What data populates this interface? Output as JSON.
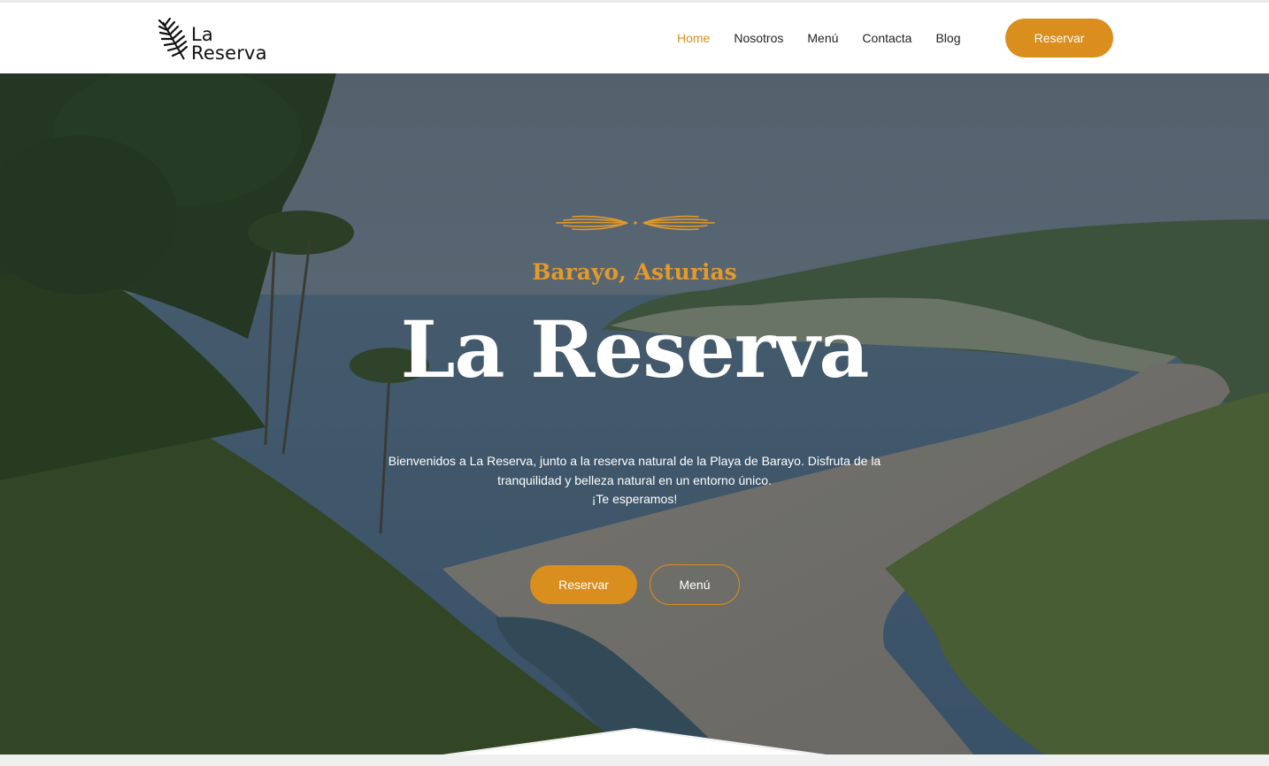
{
  "brand": {
    "logo_line1": "La",
    "logo_line2": "Reserva"
  },
  "nav": {
    "items": [
      "Home",
      "Nosotros",
      "Menú",
      "Contacta",
      "Blog"
    ],
    "active": "Home",
    "cta_label": "Reservar"
  },
  "hero": {
    "subtitle": "Barayo, Asturias",
    "title": "La Reserva",
    "description_line1": "Bienvenidos a La Reserva, junto a la reserva natural de la Playa de Barayo. Disfruta de la",
    "description_line2": "tranquilidad y belleza natural en un entorno único.",
    "description_line3": "¡Te esperamos!",
    "primary_button": "Reservar",
    "secondary_button": "Menú"
  },
  "colors": {
    "accent": "#d98e1e",
    "nav_text": "#222222",
    "hero_text": "#ffffff"
  },
  "icons": {
    "logo": "fern-leaf-icon",
    "ornament": "decorative-flourish-icon"
  }
}
